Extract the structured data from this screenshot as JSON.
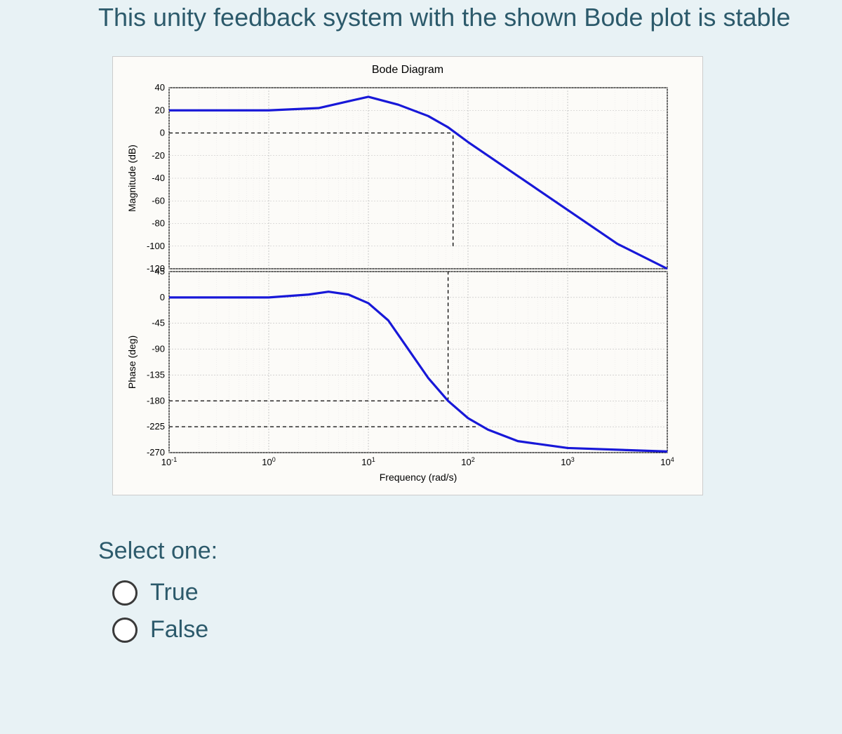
{
  "question_text": "This unity feedback system with the shown Bode plot is stable",
  "prompt_text": "Select one:",
  "options": [
    "True",
    "False"
  ],
  "chart_data": {
    "type": "line",
    "title": "Bode Diagram",
    "xlabel": "Frequency (rad/s)",
    "x_scale": "log",
    "x_ticks": [
      -1,
      0,
      1,
      2,
      3,
      4
    ],
    "x_tick_labels": [
      "10⁻¹",
      "10⁰",
      "10¹",
      "10²",
      "10³",
      "10⁴"
    ],
    "subplots": [
      {
        "ylabel": "Magnitude (dB)",
        "ylim": [
          -120,
          40
        ],
        "yticks": [
          40,
          20,
          0,
          -20,
          -40,
          -60,
          -80,
          -100,
          -120
        ],
        "series": [
          {
            "name": "magnitude",
            "logx": [
              -1,
              0,
              0.5,
              0.8,
              1.0,
              1.3,
              1.6,
              1.8,
              2.0,
              2.5,
              3.0,
              3.5,
              4.0
            ],
            "y": [
              20,
              20,
              22,
              28,
              32,
              25,
              15,
              5,
              -8,
              -38,
              -68,
              -98,
              -120
            ]
          }
        ],
        "markers": {
          "zero_db_to_pc": {
            "x1": -1,
            "x2": 1.85,
            "y": 0
          },
          "vline_at_pc": {
            "x": 1.85,
            "y1": -100,
            "y2": 0
          }
        }
      },
      {
        "ylabel": "Phase (deg)",
        "ylim": [
          -270,
          45
        ],
        "yticks": [
          45,
          0,
          -45,
          -90,
          -135,
          -180,
          -225,
          -270
        ],
        "series": [
          {
            "name": "phase",
            "logx": [
              -1,
              0,
              0.4,
              0.6,
              0.8,
              1.0,
              1.2,
              1.4,
              1.6,
              1.8,
              2.0,
              2.2,
              2.5,
              3.0,
              4.0
            ],
            "y": [
              0,
              0,
              5,
              10,
              5,
              -10,
              -40,
              -90,
              -140,
              -180,
              -210,
              -230,
              -250,
              -262,
              -268
            ]
          }
        ],
        "markers": {
          "neg180_line": {
            "x1": -1,
            "x2": 1.8,
            "y": -180
          },
          "vline_at_gc": {
            "x": 1.8,
            "y1": -180,
            "y2": 45
          },
          "neg225_line": {
            "x1": -1,
            "x2": 2.1,
            "y": -225
          }
        }
      }
    ]
  }
}
